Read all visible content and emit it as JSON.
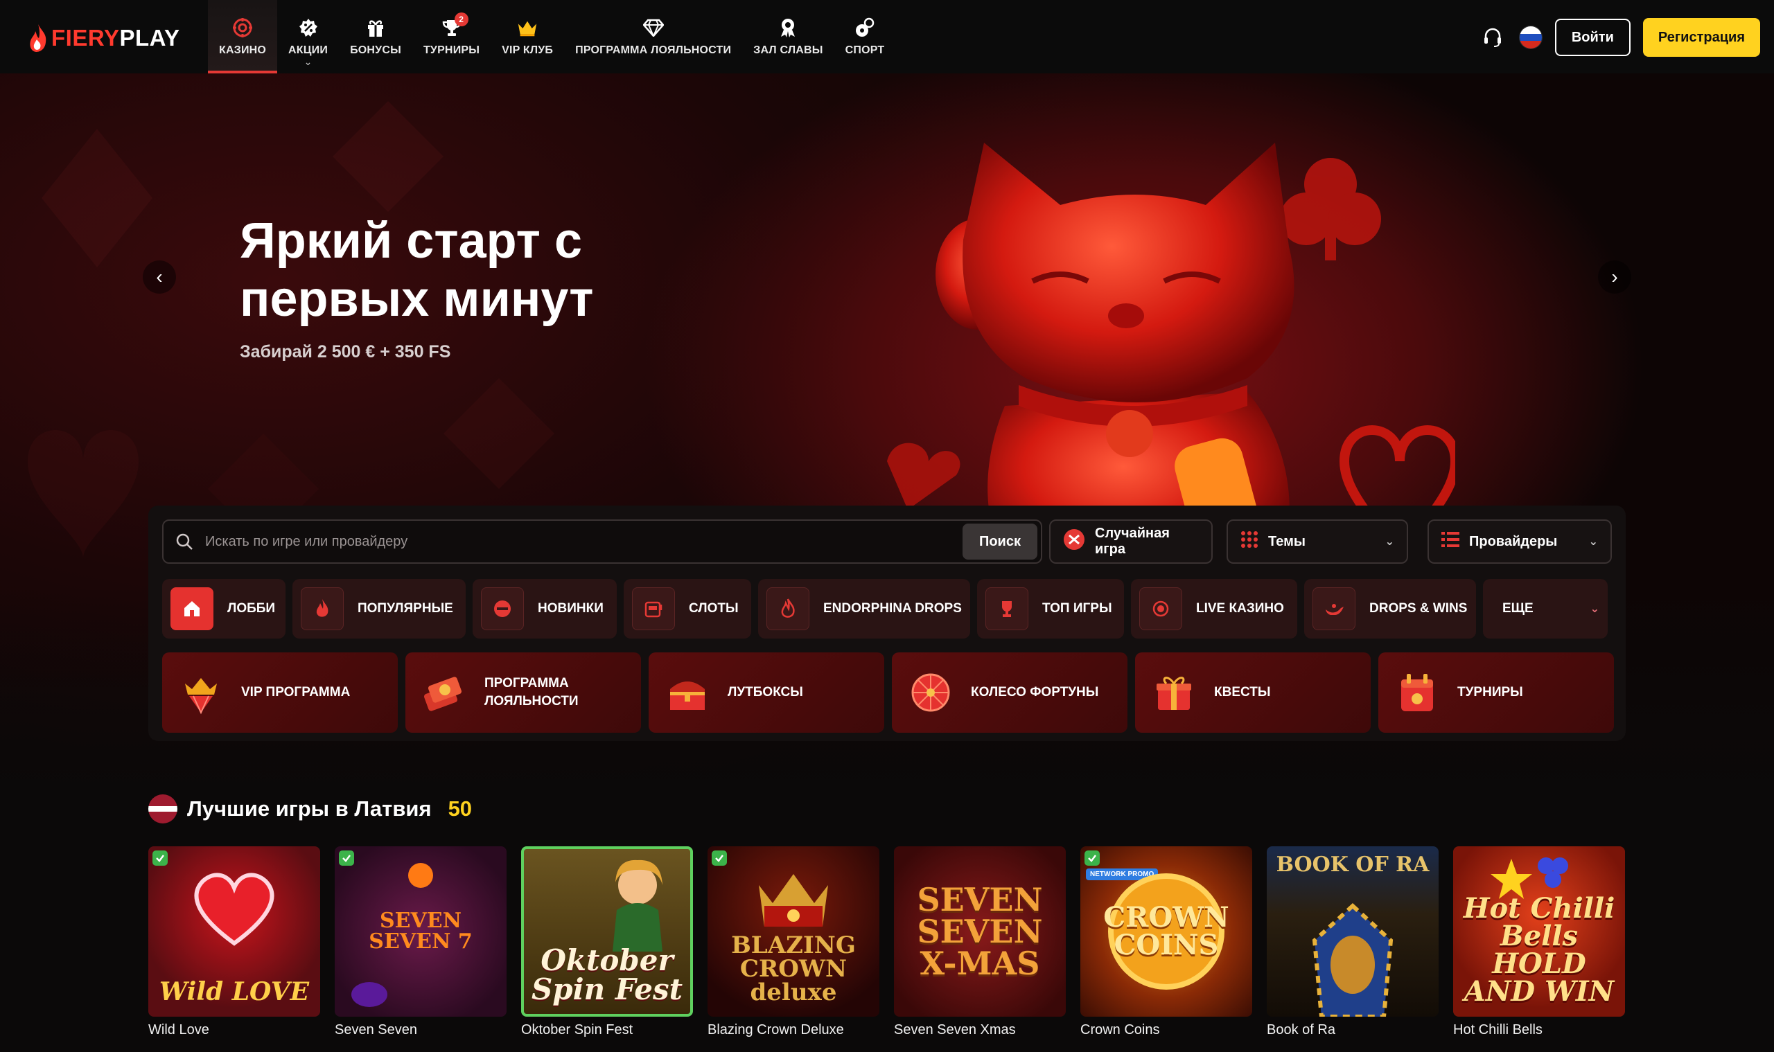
{
  "brand": {
    "part1": "FIERY",
    "part2": "PLAY"
  },
  "nav": [
    {
      "label": "КАЗИНО",
      "icon": "casino-chip-icon",
      "active": true
    },
    {
      "label": "АКЦИИ",
      "icon": "percent-badge-icon",
      "dropdown": true
    },
    {
      "label": "БОНУСЫ",
      "icon": "gift-icon"
    },
    {
      "label": "ТУРНИРЫ",
      "icon": "trophy-icon",
      "badge": "2"
    },
    {
      "label": "VIP КЛУБ",
      "icon": "crown-icon"
    },
    {
      "label": "ПРОГРАММА ЛОЯЛЬНОСТИ",
      "icon": "diamond-icon"
    },
    {
      "label": "ЗАЛ СЛАВЫ",
      "icon": "medal-icon"
    },
    {
      "label": "СПОРТ",
      "icon": "sports-ball-icon"
    }
  ],
  "header": {
    "login": "Войти",
    "register": "Регистрация",
    "language": "RU"
  },
  "hero": {
    "title": "Яркий старт с первых минут",
    "subtitle": "Забирай 2 500 € + 350 FS"
  },
  "search": {
    "placeholder": "Искать по игре или провайдеру",
    "button": "Поиск",
    "random": "Случайная игра",
    "themes": "Темы",
    "providers": "Провайдеры"
  },
  "categories": [
    {
      "label": "ЛОББИ",
      "icon": "home-icon",
      "active": true
    },
    {
      "label": "ПОПУЛЯРНЫЕ",
      "icon": "flame-icon"
    },
    {
      "label": "НОВИНКИ",
      "icon": "new-icon"
    },
    {
      "label": "СЛОТЫ",
      "icon": "slot-machine-icon"
    },
    {
      "label": "ENDORPHINA DROPS",
      "icon": "drop-flame-icon"
    },
    {
      "label": "ТОП ИГРЫ",
      "icon": "cup-icon"
    },
    {
      "label": "LIVE КАЗИНО",
      "icon": "live-icon"
    },
    {
      "label": "DROPS & WINS",
      "icon": "genie-lamp-icon"
    },
    {
      "label": "ЕЩЕ",
      "icon": "",
      "dropdown": true
    }
  ],
  "promos": [
    {
      "label": "VIP ПРОГРАММА",
      "icon": "vip-crown-gem-icon"
    },
    {
      "label": "ПРОГРАММА ЛОЯЛЬНОСТИ",
      "icon": "coins-stack-icon"
    },
    {
      "label": "ЛУТБОКСЫ",
      "icon": "treasure-chest-icon"
    },
    {
      "label": "КОЛЕСО ФОРТУНЫ",
      "icon": "fortune-wheel-icon"
    },
    {
      "label": "КВЕСТЫ",
      "icon": "quest-box-icon"
    },
    {
      "label": "ТУРНИРЫ",
      "icon": "tournament-calendar-icon"
    }
  ],
  "section": {
    "title": "Лучшие игры в Латвия",
    "count": "50"
  },
  "games": [
    {
      "name": "Wild Love",
      "thumb_text": "Wild LOVE",
      "bg": "#5a0d12",
      "fg": "#ffcf4a"
    },
    {
      "name": "Seven Seven",
      "thumb_text": "SEVEN SEVEN 7",
      "bg": "#3a0d2a",
      "fg": "#ff8a1e"
    },
    {
      "name": "Oktober Spin Fest",
      "thumb_text": "Oktober Spin Fest",
      "bg": "#4c3a10",
      "fg": "#fff4d8"
    },
    {
      "name": "Blazing Crown Deluxe",
      "thumb_text": "BLAZING CROWN deluxe",
      "bg": "#3b0a08",
      "fg": "#e6b24a"
    },
    {
      "name": "Seven Seven Xmas",
      "thumb_text": "SEVEN SEVEN X-MAS",
      "bg": "#5b1212",
      "fg": "#f3a23a"
    },
    {
      "name": "Crown Coins",
      "thumb_text": "CROWN COINS",
      "bg": "#6a1a06",
      "fg": "#ffd25a",
      "tag": "NETWORK PROMO"
    },
    {
      "name": "Book of Ra",
      "thumb_text": "BOOK OF RA",
      "bg": "#2a1f10",
      "fg": "#e8c36a"
    },
    {
      "name": "Hot Chilli Bells",
      "thumb_text": "Hot Chilli Bells HOLD AND WIN",
      "bg": "#7a1408",
      "fg": "#ffe08a"
    }
  ],
  "colors": {
    "accent": "#e53935",
    "cta": "#ffd21f",
    "background": "#0b0909"
  }
}
